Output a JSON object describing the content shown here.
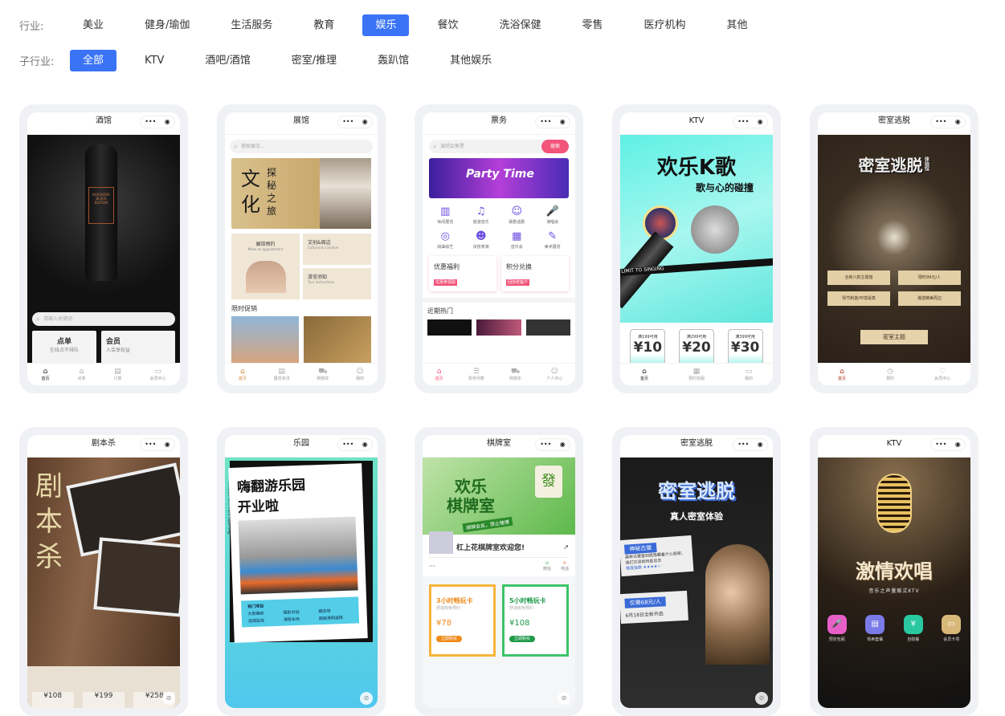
{
  "filters": {
    "industry_label": "行业:",
    "industries": [
      "美业",
      "健身/瑜伽",
      "生活服务",
      "教育",
      "娱乐",
      "餐饮",
      "洗浴保健",
      "零售",
      "医疗机构",
      "其他"
    ],
    "industry_active": 4,
    "sub_label": "子行业:",
    "subs": [
      "全部",
      "KTV",
      "酒吧/酒馆",
      "密室/推理",
      "轰趴馆",
      "其他娱乐"
    ],
    "sub_active": 0
  },
  "colors": {
    "accent": "#3a73f6"
  },
  "cards": {
    "bar": {
      "title": "酒馆",
      "search": "请输入关键词",
      "tile1_title": "点单",
      "tile1_sub": "在线点不排队",
      "tile2_title": "会员",
      "tile2_sub": "入会享权益",
      "bottle": "KARUKERA BLACK EDITION",
      "tabs": [
        "首页",
        "点单",
        "订单",
        "会员中心"
      ]
    },
    "museum": {
      "title": "展馆",
      "search": "搜索展览...",
      "banner1": "文化",
      "banner2": "探秘之旅",
      "t1": "展馆预约",
      "t1en": "Make an appointment",
      "t2": "文创&周边",
      "t2en": "Cultural & Creative",
      "t3": "游览须知",
      "t3en": "Tour instructions",
      "section": "限时促销",
      "tabs": [
        "首页",
        "展览资讯",
        "购物车",
        "我的"
      ]
    },
    "ticket": {
      "title": "票务",
      "search": "演唱会售票",
      "search_btn": "搜索",
      "banner": "Party Time",
      "icons": [
        "休闲展览",
        "摇滚音乐",
        "歌剧话剧",
        "演唱会",
        "戏曲综艺",
        "杂技表演",
        "音乐会",
        "美术展览"
      ],
      "p1": "优惠福利",
      "p1b": "优惠券领取",
      "p2": "积分兑换",
      "p2b": "回馈老客户",
      "section": "近期热门",
      "tabs": [
        "首页",
        "票务列表",
        "购物车",
        "个人中心"
      ]
    },
    "ktv1": {
      "title": "KTV",
      "h1": "欢乐K歌",
      "h2": "歌与心的碰撞",
      "ribbon": "NO LIMIT TO SINGING",
      "coupons": [
        {
          "cond": "满199可用",
          "val": "¥10"
        },
        {
          "cond": "满299可用",
          "val": "¥20"
        },
        {
          "cond": "满399可用",
          "val": "¥30"
        }
      ],
      "tabs": [
        "首页",
        "预约包厢",
        "我的"
      ]
    },
    "escape1": {
      "title": "密室逃脱",
      "h1": "密室逃脱",
      "h1s": "体验馆",
      "boards": [
        "全新六款主题馆",
        "限时99元/人",
        "情节刺激/环境逼真",
        "潮送精美周边"
      ],
      "bottom": "密室主题",
      "tabs": [
        "首页",
        "预约",
        "会员中心"
      ]
    },
    "script": {
      "title": "剧本杀",
      "h1": "剧本杀",
      "prices": [
        "¥108",
        "¥199",
        "¥258"
      ]
    },
    "park": {
      "title": "乐园",
      "h1": "嗨翻游乐园",
      "h2": "开业啦",
      "side": "Amusement Park Opening",
      "hot": "热门项目",
      "items": [
        "大型蹦床",
        "镭射对战",
        "蹦击球",
        "逃城监狱",
        "漂移车场",
        "超级滑翔速降"
      ]
    },
    "chess": {
      "title": "棋牌室",
      "h1": "欢乐",
      "h2": "棋牌室",
      "slogan": "棋牌会友，禁止赌博",
      "welcome": "杠上花棋牌室欢迎您!",
      "more": "···",
      "wx": "微信",
      "tel": "电话",
      "c1": "3小时畅玩卡",
      "c1s": "舒适房免预约",
      "c1p": "¥78",
      "c2": "5小时畅玩卡",
      "c2s": "舒适房免预约",
      "c2p": "¥108",
      "buy": "立即购买"
    },
    "escape2": {
      "title": "密室逃脱",
      "h1": "密室逃脱",
      "h2": "真人密室体验",
      "tag": "神秘古堡",
      "desc": "森林古堡里到底隐藏着什么秘密，我们又该如何走出去",
      "diff": "难度指数 ★★★★☆",
      "price": "仅需68元/人",
      "date": "6月18日全新开启"
    },
    "ktv2": {
      "title": "KTV",
      "h1": "激情欢唱",
      "h2": "音乐之声量贩式KTV",
      "icons": [
        "预定包厢",
        "热卖套餐",
        "自助餐",
        "会员卡项"
      ]
    }
  }
}
